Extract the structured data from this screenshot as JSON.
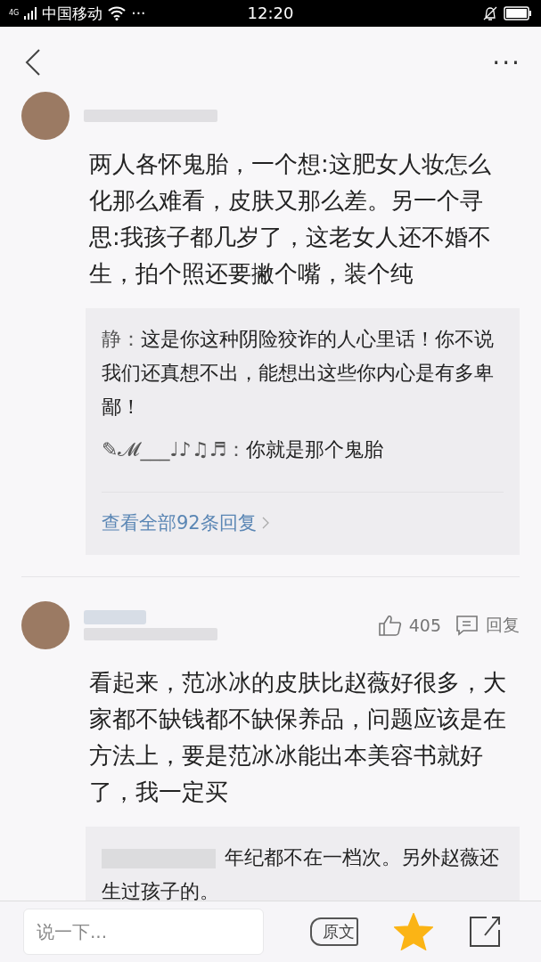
{
  "status_bar": {
    "network": "4G",
    "carrier": "中国移动",
    "more": "···",
    "time": "12:20"
  },
  "nav": {
    "more": "···"
  },
  "comments": [
    {
      "text": "两人各怀鬼胎，一个想:这肥女人妆怎么化那么难看，皮肤又那么差。另一个寻思:我孩子都几岁了，这老女人还不婚不生，拍个照还要撇个嘴，装个纯",
      "replies": [
        {
          "author": "静：",
          "text": "这是你这种阴险狡诈的人心里话！你不说我们还真想不出，能想出这些你内心是有多卑鄙！"
        },
        {
          "author": "✎𝓜___♩♪♫♬：",
          "text": "你就是那个鬼胎"
        }
      ],
      "view_all": "查看全部92条回复"
    },
    {
      "text": "看起来，范冰冰的皮肤比赵薇好很多，大家都不缺钱都不缺保养品，问题应该是在方法上，要是范冰冰能出本美容书就好了，我一定买",
      "likes": "405",
      "reply_label": "回复",
      "replies": [
        {
          "text": "年纪都不在一档次。另外赵薇还生过孩子的。"
        }
      ]
    }
  ],
  "bottom_bar": {
    "placeholder": "说一下...",
    "original_label": "原文",
    "favorite_selected": true
  }
}
